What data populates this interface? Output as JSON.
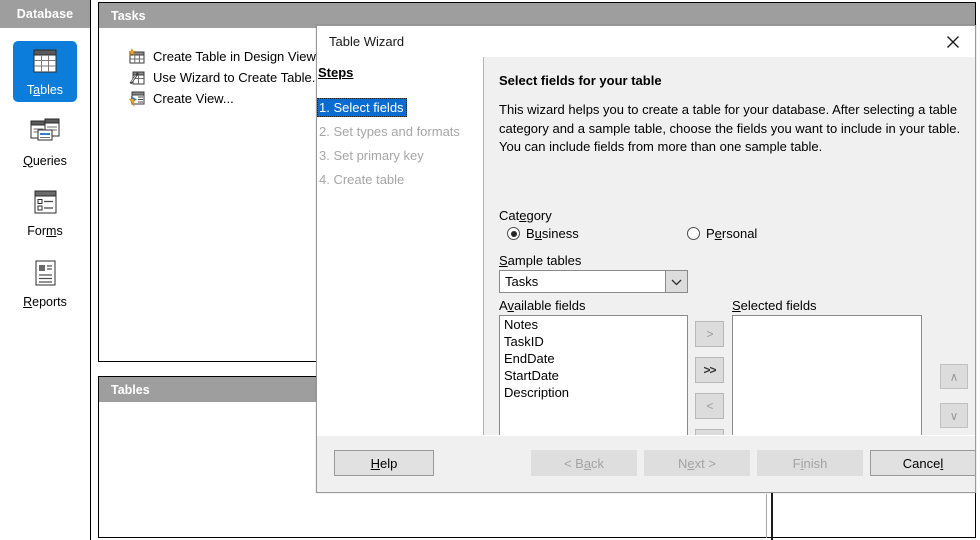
{
  "sidebar": {
    "header": "Database",
    "items": [
      {
        "label_pre": "T",
        "label_accel": "a",
        "label_post": "bles",
        "label": "Tables",
        "icon": "table-grid-icon",
        "selected": true
      },
      {
        "label_pre": "",
        "label_accel": "Q",
        "label_post": "ueries",
        "label": "Queries",
        "icon": "query-icon",
        "selected": false
      },
      {
        "label_pre": "For",
        "label_accel": "m",
        "label_post": "s",
        "label": "Forms",
        "icon": "form-icon",
        "selected": false
      },
      {
        "label_pre": "",
        "label_accel": "R",
        "label_post": "eports",
        "label": "Reports",
        "icon": "report-icon",
        "selected": false
      }
    ]
  },
  "tasks_panel": {
    "header": "Tasks",
    "items": [
      {
        "label": "Create Table in Design View...",
        "icon": "table-design-icon"
      },
      {
        "label": "Use Wizard to Create Table...",
        "icon": "wand-icon"
      },
      {
        "label": "Create View...",
        "icon": "create-view-icon"
      }
    ]
  },
  "tables_panel": {
    "header": "Tables"
  },
  "wizard": {
    "title": "Table Wizard",
    "close_icon": "close-icon",
    "steps_title": "Steps",
    "steps": [
      {
        "label": "1. Select fields",
        "active": true
      },
      {
        "label": "2. Set types and formats",
        "active": false
      },
      {
        "label": "3. Set primary key",
        "active": false
      },
      {
        "label": "4. Create table",
        "active": false
      }
    ],
    "heading": "Select fields for your table",
    "description": "This wizard helps you to create a table for your database. After selecting a table category and a sample table, choose the fields you want to include in your table. You can include fields from more than one sample table.",
    "category": {
      "label_pre": "Cat",
      "label_accel": "e",
      "label_post": "gory",
      "label": "Category",
      "options": [
        {
          "label_pre": "B",
          "label_accel": "u",
          "label_post": "siness",
          "label": "Business",
          "selected": true
        },
        {
          "label_pre": "P",
          "label_accel": "e",
          "label_post": "rsonal",
          "label": "Personal",
          "selected": false
        }
      ]
    },
    "sample_tables": {
      "label_pre": "",
      "label_accel": "S",
      "label_post": "ample tables",
      "label": "Sample tables",
      "value": "Tasks",
      "arrow_icon": "chevron-down-icon"
    },
    "available_fields": {
      "label_pre": "A",
      "label_accel": "v",
      "label_post": "ailable fields",
      "label": "Available fields",
      "items": [
        "Notes",
        "TaskID",
        "EndDate",
        "StartDate",
        "Description"
      ]
    },
    "selected_fields": {
      "label_pre": "",
      "label_accel": "S",
      "label_post": "elected fields",
      "label": "Selected fields",
      "items": []
    },
    "transfer_buttons": [
      {
        "label": ">",
        "name": "move-right-button",
        "enabled": false
      },
      {
        "label": ">>",
        "name": "move-all-right-button",
        "enabled": true
      },
      {
        "label": "<",
        "name": "move-left-button",
        "enabled": false
      },
      {
        "label": "<<",
        "name": "move-all-left-button",
        "enabled": false
      }
    ],
    "order_buttons": [
      {
        "label": "∧",
        "name": "move-up-button",
        "enabled": false
      },
      {
        "label": "∨",
        "name": "move-down-button",
        "enabled": false
      }
    ],
    "footer_buttons": [
      {
        "label_pre": "H",
        "label_accel": "e",
        "label_post": "lp",
        "label": "Help",
        "enabled": true
      },
      {
        "label_pre": "< B",
        "label_accel": "a",
        "label_post": "ck",
        "label": "< Back",
        "enabled": false
      },
      {
        "label_pre": "N",
        "label_accel": "e",
        "label_post": "xt >",
        "label": "Next >",
        "enabled": false
      },
      {
        "label_pre": "F",
        "label_accel": "i",
        "label_post": "nish",
        "label": "Finish",
        "enabled": false
      },
      {
        "label_pre": "Cance",
        "label_accel": "l",
        "label_post": "",
        "label": "Cancel",
        "enabled": true
      }
    ]
  },
  "colors": {
    "accent_blue": "#0d7ddb",
    "step_active_blue": "#0a6cd0",
    "panel_header_gray": "#9e9e9e",
    "dialog_bg": "#f0f0f0"
  }
}
